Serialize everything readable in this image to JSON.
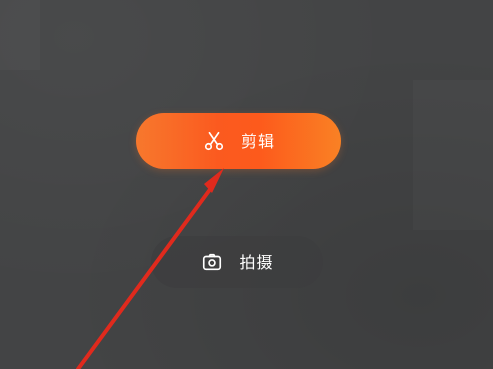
{
  "actions": {
    "edit": {
      "label": "剪辑",
      "icon": "scissors-icon"
    },
    "shoot": {
      "label": "拍摄",
      "icon": "camera-icon"
    }
  },
  "colors": {
    "background": "#434445",
    "edit_gradient_start": "#f7782d",
    "edit_gradient_end": "#f98124",
    "annotation_arrow": "#e02a1d"
  }
}
